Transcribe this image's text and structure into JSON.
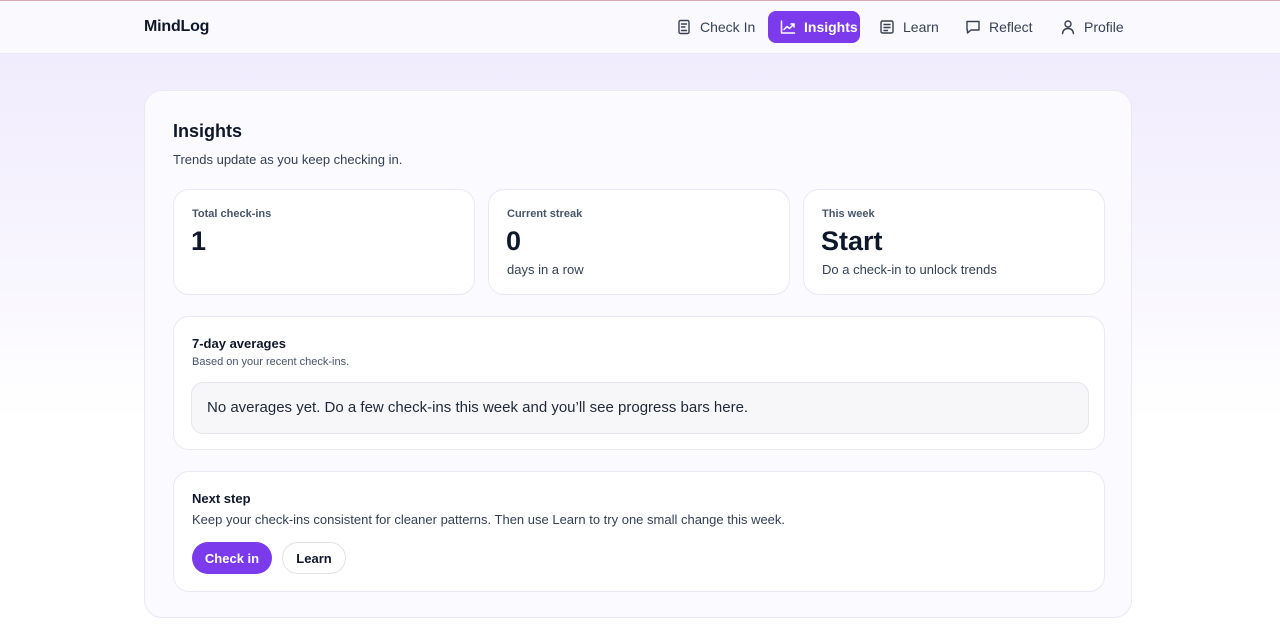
{
  "app": {
    "name": "MindLog"
  },
  "nav": {
    "items": [
      {
        "label": "Check In",
        "icon": "notebook-icon"
      },
      {
        "label": "Insights",
        "icon": "line-chart-icon",
        "active": true
      },
      {
        "label": "Learn",
        "icon": "book-icon"
      },
      {
        "label": "Reflect",
        "icon": "chat-bubble-icon"
      },
      {
        "label": "Profile",
        "icon": "user-icon"
      }
    ]
  },
  "colors": {
    "accent": "#7c3aed"
  },
  "page": {
    "title": "Insights",
    "subtitle": "Trends update as you keep checking in."
  },
  "stats": [
    {
      "label": "Total check-ins",
      "value": "1",
      "sub": ""
    },
    {
      "label": "Current streak",
      "value": "0",
      "sub": "days in a row"
    },
    {
      "label": "This week",
      "value": "Start",
      "sub": "Do a check-in to unlock trends"
    }
  ],
  "averages": {
    "title": "7-day averages",
    "subtitle": "Based on your recent check-ins.",
    "empty_message": "No averages yet. Do a few check-ins this week and you’ll see progress bars here."
  },
  "next_step": {
    "title": "Next step",
    "text": "Keep your check-ins consistent for cleaner patterns. Then use Learn to try one small change this week.",
    "primary_button": "Check in",
    "secondary_button": "Learn"
  }
}
